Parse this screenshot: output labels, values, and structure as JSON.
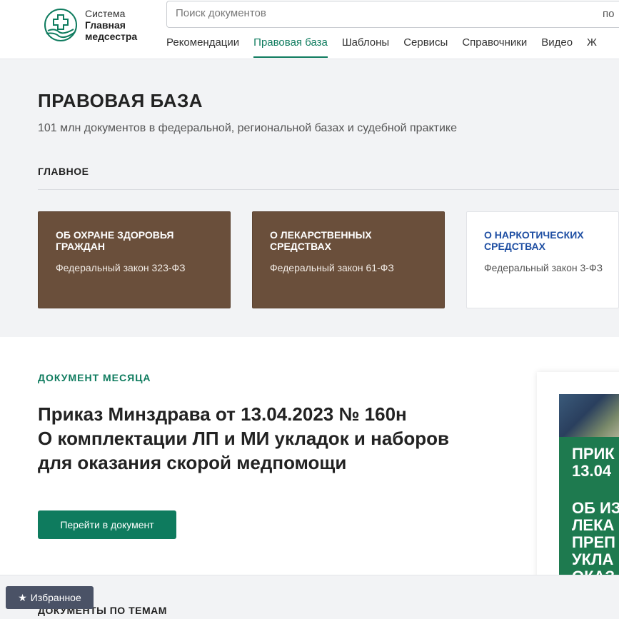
{
  "header": {
    "logo": {
      "line1": "Система",
      "line2": "Главная",
      "line3": "медсестра"
    },
    "search": {
      "placeholder": "Поиск документов",
      "button_label": "по"
    },
    "nav": [
      {
        "label": "Рекомендации",
        "active": false
      },
      {
        "label": "Правовая база",
        "active": true
      },
      {
        "label": "Шаблоны",
        "active": false
      },
      {
        "label": "Сервисы",
        "active": false
      },
      {
        "label": "Справочники",
        "active": false
      },
      {
        "label": "Видео",
        "active": false
      },
      {
        "label": "Ж",
        "active": false
      }
    ]
  },
  "legal": {
    "title": "ПРАВОВАЯ БАЗА",
    "subtitle": "101 млн документов в федеральной, региональной базах и судебной практике",
    "main_label": "ГЛАВНОЕ",
    "cards": [
      {
        "title": "ОБ ОХРАНЕ ЗДОРОВЬЯ ГРАЖДАН",
        "desc": "Федеральный закон 323-ФЗ"
      },
      {
        "title": "О ЛЕКАРСТВЕННЫХ СРЕДСТВАХ",
        "desc": "Федеральный закон 61-ФЗ"
      },
      {
        "title": "О НАРКОТИЧЕСКИХ СРЕДСТВАХ",
        "desc": "Федеральный закон 3-ФЗ"
      }
    ]
  },
  "doc_month": {
    "label": "ДОКУМЕНТ МЕСЯЦА",
    "title_line1": "Приказ Минздрава от 13.04.2023 № 160н",
    "title_line2": "О комплектации ЛП и МИ укладок и наборов",
    "title_line3": "для оказания скорой медпомощи",
    "button_label": "Перейти в документ",
    "promo": {
      "text1_l1": "ПРИК",
      "text1_l2": "13.04",
      "text2_l1": "ОБ ИЗ",
      "text2_l2": "ЛЕКА",
      "text2_l3": "ПРЕП",
      "text2_l4": "УКЛА",
      "text2_l5": "ОКАЗ"
    }
  },
  "bottom": {
    "title": "ДОКУМЕНТЫ ПО ТЕМАМ"
  },
  "favorites": {
    "label": "Избранное"
  },
  "colors": {
    "accent": "#0e7b5e",
    "card_brown": "#6a4f3b",
    "link_blue": "#1f4fa3",
    "fav_bg": "#4a5266"
  }
}
